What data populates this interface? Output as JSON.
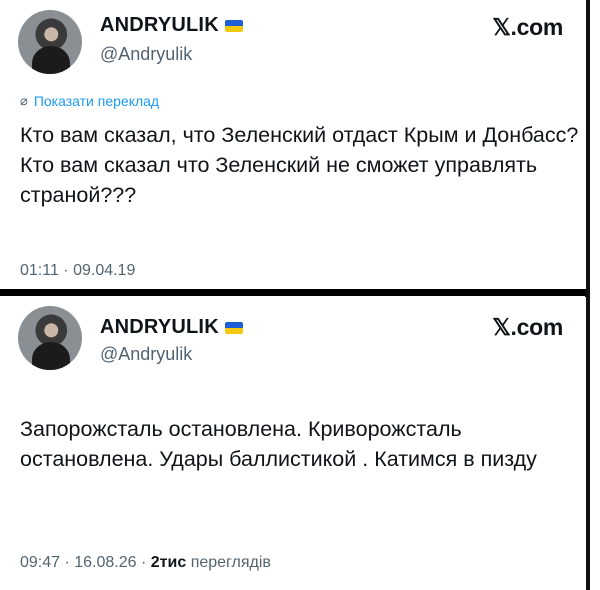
{
  "tweets": [
    {
      "display_name": "ANDRYULIK",
      "handle": "@Andryulik",
      "site": "𝕏.com",
      "translate_label": "Показати переклад",
      "text": "Кто вам сказал, что Зеленский отдаст Крым и Донбасс? Кто вам сказал что Зеленский не сможет управлять страной???",
      "timestamp": "01:11 · 09.04.19"
    },
    {
      "display_name": "ANDRYULIK",
      "handle": "@Andryulik",
      "site": "𝕏.com",
      "text": "Запорожсталь остановлена. Криворожсталь остановлена. Удары баллистикой . Катимся в пизду",
      "timestamp": "09:47 · 16.08.26 · ",
      "views_count": "2тис",
      "views_label": "переглядів"
    }
  ],
  "icons": {
    "flag": "ukraine-flag-icon",
    "translate": "globe-icon"
  },
  "colors": {
    "flag_blue": "#1f5fd6",
    "flag_yellow": "#f3c80f",
    "link": "#1d9bf0",
    "secondary_text": "#536471"
  }
}
